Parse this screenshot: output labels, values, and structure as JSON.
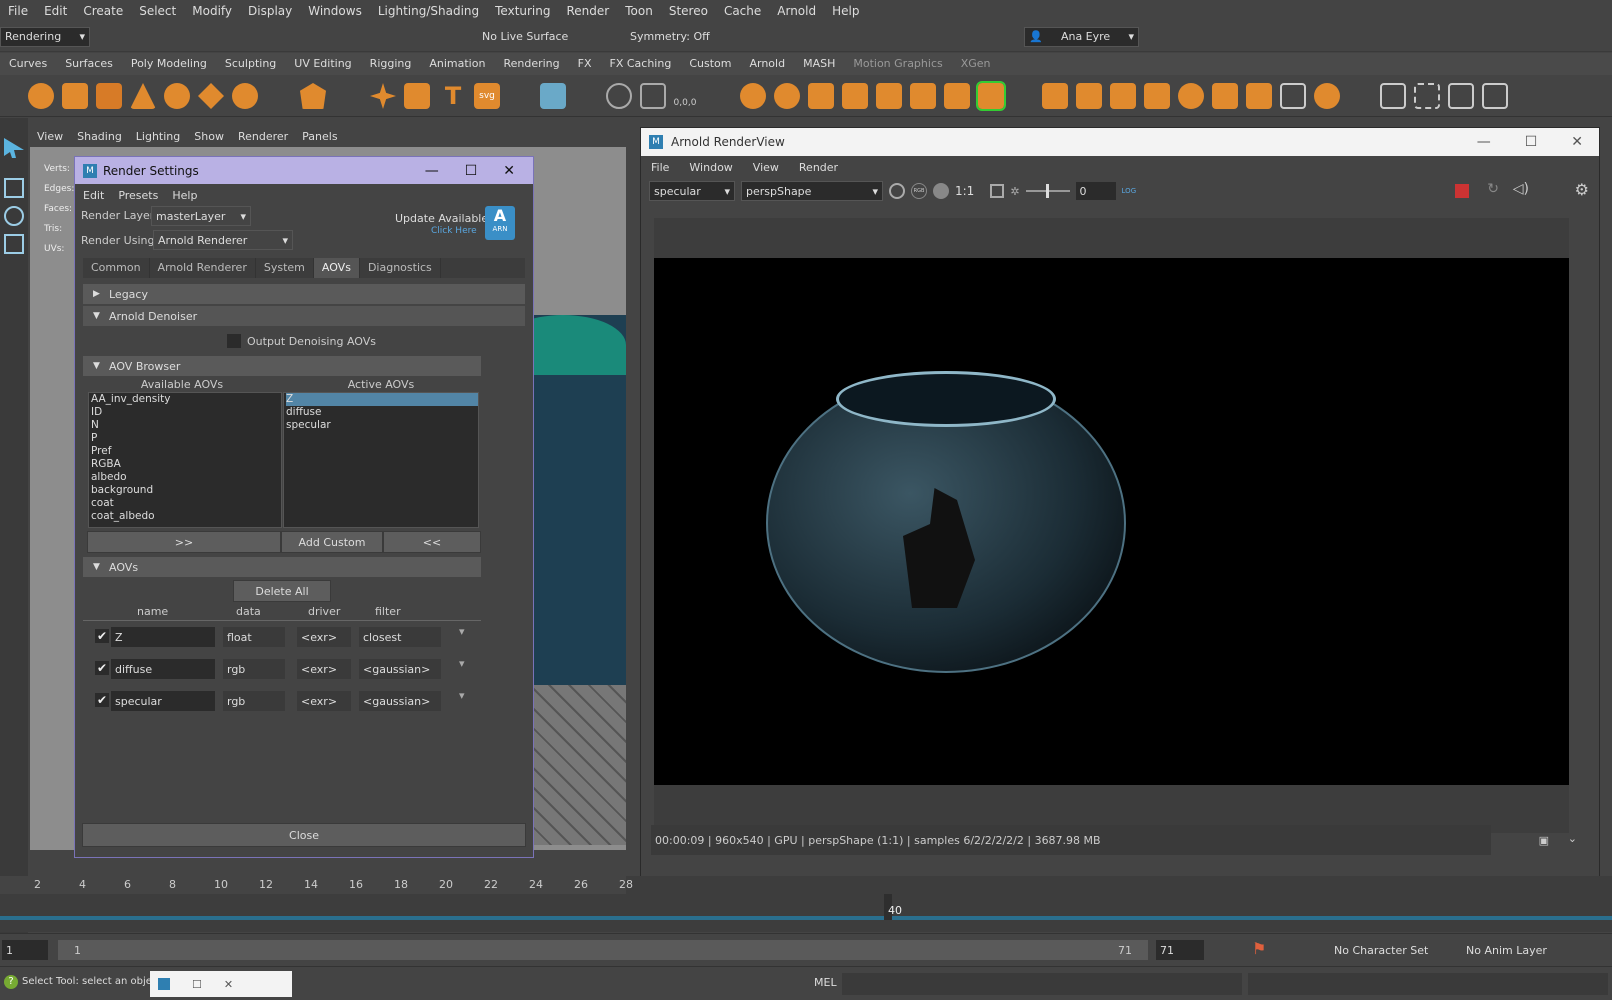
{
  "menu": [
    "File",
    "Edit",
    "Create",
    "Select",
    "Modify",
    "Display",
    "Windows",
    "Lighting/Shading",
    "Texturing",
    "Render",
    "Toon",
    "Stereo",
    "Cache",
    "Arnold",
    "Help"
  ],
  "status": {
    "mode": "Rendering",
    "live_surface": "No Live Surface",
    "symmetry": "Symmetry: Off",
    "user": "Ana Eyre"
  },
  "shelf_tabs": [
    "Curves",
    "Surfaces",
    "Poly Modeling",
    "Sculpting",
    "UV Editing",
    "Rigging",
    "Animation",
    "Rendering",
    "FX",
    "FX Caching",
    "Custom",
    "Arnold",
    "MASH",
    "Motion Graphics",
    "XGen"
  ],
  "shelf_extra": {
    "xyz": "0,0,0",
    "svg": "svg"
  },
  "viewport": {
    "menu": [
      "View",
      "Shading",
      "Lighting",
      "Show",
      "Renderer",
      "Panels"
    ],
    "hud": [
      "Verts:",
      "Edges:",
      "Faces:",
      "Tris:",
      "UVs:"
    ]
  },
  "render_settings": {
    "title": "Render Settings",
    "menu": [
      "Edit",
      "Presets",
      "Help"
    ],
    "render_layer_label": "Render Layer",
    "render_layer": "masterLayer",
    "render_using_label": "Render Using",
    "render_using": "Arnold Renderer",
    "update": "Update Available",
    "click_here": "Click Here",
    "badge": "A",
    "badge_sub": "ARN",
    "tabs": [
      "Common",
      "Arnold Renderer",
      "System",
      "AOVs",
      "Diagnostics"
    ],
    "legacy": "Legacy",
    "denoiser": "Arnold Denoiser",
    "output_denoising": "Output Denoising AOVs",
    "aov_browser": "AOV Browser",
    "available_label": "Available AOVs",
    "active_label": "Active AOVs",
    "available": [
      "AA_inv_density",
      "ID",
      "N",
      "P",
      "Pref",
      "RGBA",
      "albedo",
      "background",
      "coat",
      "coat_albedo"
    ],
    "active": [
      "Z",
      "diffuse",
      "specular"
    ],
    "btn_add": ">>",
    "btn_custom": "Add Custom",
    "btn_remove": "<<",
    "aovs_section": "AOVs",
    "delete_all": "Delete All",
    "cols": [
      "name",
      "data",
      "driver",
      "filter"
    ],
    "rows": [
      {
        "name": "Z",
        "data": "float",
        "driver": "<exr>",
        "filter": "closest"
      },
      {
        "name": "diffuse",
        "data": "rgb",
        "driver": "<exr>",
        "filter": "<gaussian>"
      },
      {
        "name": "specular",
        "data": "rgb",
        "driver": "<exr>",
        "filter": "<gaussian>"
      }
    ],
    "close": "Close"
  },
  "renderview": {
    "title": "Arnold RenderView",
    "menu": [
      "File",
      "Window",
      "View",
      "Render"
    ],
    "aov": "specular",
    "camera": "perspShape",
    "ratio": "1:1",
    "exposure": "0",
    "log": "LOG",
    "rgb": "RGB",
    "status": "00:00:09 | 960x540 | GPU | perspShape (1:1) | samples 6/2/2/2/2/2 | 3687.98 MB"
  },
  "timeline": {
    "ticks": [
      "2",
      "4",
      "6",
      "8",
      "10",
      "12",
      "14",
      "16",
      "18",
      "20",
      "22",
      "24",
      "26",
      "28"
    ],
    "current": "40"
  },
  "range": {
    "start": "1",
    "inner_start": "1",
    "inner_end": "71",
    "end": "71",
    "char_set": "No Character Set",
    "anim_layer": "No Anim Layer"
  },
  "help": {
    "text": "Select Tool: select an object",
    "mel": "MEL"
  }
}
